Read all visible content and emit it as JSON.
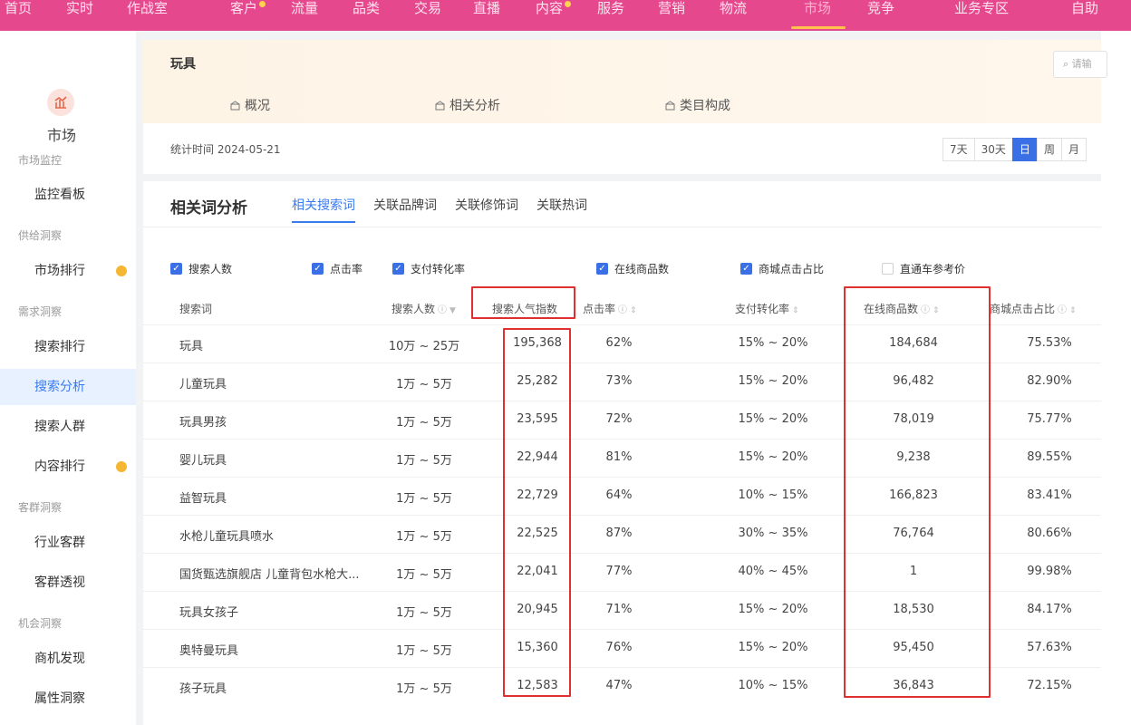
{
  "topnav": {
    "items": [
      "首页",
      "实时",
      "作战室",
      "客户",
      "流量",
      "品类",
      "交易",
      "直播",
      "内容",
      "服务",
      "营销",
      "物流",
      "市场",
      "竞争",
      "业务专区",
      "自助"
    ],
    "active_index": 12
  },
  "sidebar": {
    "title": "市场",
    "groups": [
      {
        "label": "市场监控",
        "items": [
          {
            "label": "监控看板"
          }
        ]
      },
      {
        "label": "供给洞察",
        "items": [
          {
            "label": "市场排行",
            "dot": true
          }
        ]
      },
      {
        "label": "需求洞察",
        "items": [
          {
            "label": "搜索排行"
          },
          {
            "label": "搜索分析",
            "active": true
          },
          {
            "label": "搜索人群"
          },
          {
            "label": "内容排行",
            "dot": true
          }
        ]
      },
      {
        "label": "客群洞察",
        "items": [
          {
            "label": "行业客群"
          },
          {
            "label": "客群透视"
          }
        ]
      },
      {
        "label": "机会洞察",
        "items": [
          {
            "label": "商机发现"
          },
          {
            "label": "属性洞察"
          }
        ]
      }
    ]
  },
  "header": {
    "category": "玩具",
    "tabs": [
      "概况",
      "相关分析",
      "类目构成"
    ],
    "search_placeholder": "请输",
    "stat_time": "统计时间 2024-05-21",
    "date_ranges": [
      "7天",
      "30天",
      "日",
      "周",
      "月"
    ],
    "active_range": "日"
  },
  "analysis": {
    "title": "相关词分析",
    "tabs": [
      "相关搜索词",
      "关联品牌词",
      "关联修饰词",
      "关联热词"
    ],
    "active_tab": "相关搜索词",
    "checkboxes": [
      {
        "label": "搜索人数",
        "checked": true
      },
      {
        "label": "点击率",
        "checked": true
      },
      {
        "label": "支付转化率",
        "checked": true
      },
      {
        "label": "在线商品数",
        "checked": true
      },
      {
        "label": "商城点击占比",
        "checked": true
      },
      {
        "label": "直通车参考价",
        "checked": false
      }
    ],
    "columns": {
      "word": "搜索词",
      "search_people": "搜索人数",
      "popularity": "搜索人气指数",
      "ctr": "点击率",
      "conversion": "支付转化率",
      "online_goods": "在线商品数",
      "mall_click": "商城点击占比"
    },
    "rows": [
      {
        "word": "玩具",
        "people": "10万 ~ 25万",
        "popularity": "195,368",
        "ctr": "62%",
        "conversion": "15% ~ 20%",
        "goods": "184,684",
        "mall": "75.53%"
      },
      {
        "word": "儿童玩具",
        "people": "1万 ~ 5万",
        "popularity": "25,282",
        "ctr": "73%",
        "conversion": "15% ~ 20%",
        "goods": "96,482",
        "mall": "82.90%"
      },
      {
        "word": "玩具男孩",
        "people": "1万 ~ 5万",
        "popularity": "23,595",
        "ctr": "72%",
        "conversion": "15% ~ 20%",
        "goods": "78,019",
        "mall": "75.77%"
      },
      {
        "word": "婴儿玩具",
        "people": "1万 ~ 5万",
        "popularity": "22,944",
        "ctr": "81%",
        "conversion": "15% ~ 20%",
        "goods": "9,238",
        "mall": "89.55%"
      },
      {
        "word": "益智玩具",
        "people": "1万 ~ 5万",
        "popularity": "22,729",
        "ctr": "64%",
        "conversion": "10% ~ 15%",
        "goods": "166,823",
        "mall": "83.41%"
      },
      {
        "word": "水枪儿童玩具喷水",
        "people": "1万 ~ 5万",
        "popularity": "22,525",
        "ctr": "87%",
        "conversion": "30% ~ 35%",
        "goods": "76,764",
        "mall": "80.66%"
      },
      {
        "word": "国货甄选旗舰店 儿童背包水枪大...",
        "people": "1万 ~ 5万",
        "popularity": "22,041",
        "ctr": "77%",
        "conversion": "40% ~ 45%",
        "goods": "1",
        "mall": "99.98%"
      },
      {
        "word": "玩具女孩子",
        "people": "1万 ~ 5万",
        "popularity": "20,945",
        "ctr": "71%",
        "conversion": "15% ~ 20%",
        "goods": "18,530",
        "mall": "84.17%"
      },
      {
        "word": "奥特曼玩具",
        "people": "1万 ~ 5万",
        "popularity": "15,360",
        "ctr": "76%",
        "conversion": "15% ~ 20%",
        "goods": "95,450",
        "mall": "57.63%"
      },
      {
        "word": "孩子玩具",
        "people": "1万 ~ 5万",
        "popularity": "12,583",
        "ctr": "47%",
        "conversion": "10% ~ 15%",
        "goods": "36,843",
        "mall": "72.15%"
      }
    ]
  }
}
